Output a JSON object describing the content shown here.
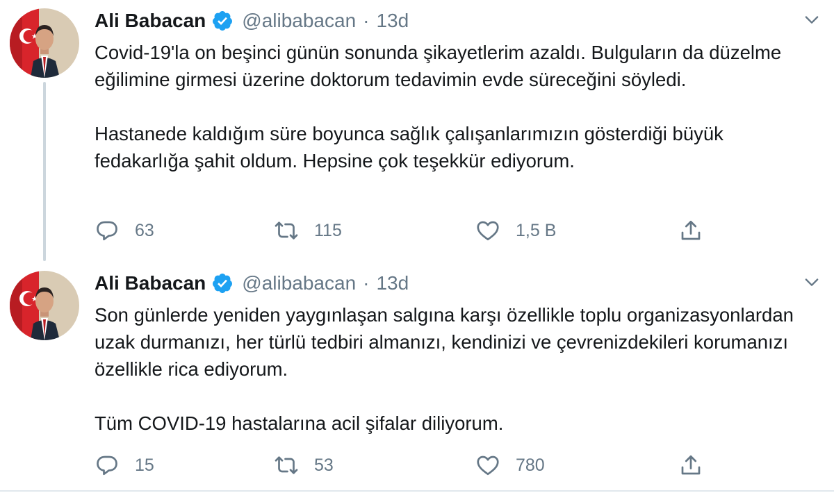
{
  "colors": {
    "text": "#14171a",
    "secondary": "#657786",
    "verified_blue": "#1da1f2",
    "thread_line": "#ccd6dd"
  },
  "tweets": [
    {
      "author_name": "Ali Babacan",
      "handle": "@alibabacan",
      "separator": "·",
      "time": "13d",
      "verified_icon": "verified-badge-icon",
      "paragraphs": [
        "Covid-19'la on beşinci günün sonunda şikayetlerim azaldı.  Bulguların da düzelme eğilimine girmesi üzerine doktorum tedavimin evde süreceğini söyledi.",
        "Hastanede kaldığım süre boyunca sağlık çalışanlarımızın gösterdiği büyük fedakarlığa şahit oldum. Hepsine çok teşekkür ediyorum."
      ],
      "replies": "63",
      "retweets": "115",
      "likes": "1,5 B"
    },
    {
      "author_name": "Ali Babacan",
      "handle": "@alibabacan",
      "separator": "·",
      "time": "13d",
      "verified_icon": "verified-badge-icon",
      "paragraphs": [
        "Son günlerde yeniden yaygınlaşan salgına karşı özellikle toplu organizasyonlardan uzak durmanızı, her türlü tedbiri almanızı, kendinizi ve çevrenizdekileri korumanızı özellikle rica ediyorum.",
        "Tüm COVID-19 hastalarına acil şifalar diliyorum."
      ],
      "replies": "15",
      "retweets": "53",
      "likes": "780"
    }
  ]
}
